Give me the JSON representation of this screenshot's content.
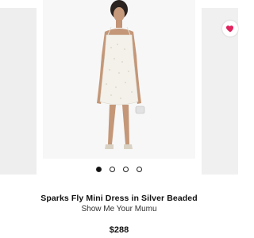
{
  "product": {
    "name": "Sparks Fly Mini Dress in Silver Beaded",
    "brand": "Show Me Your Mumu",
    "price": "$288",
    "image_icon": "dress-photo",
    "favorite_icon": "heart-icon"
  },
  "carousel": {
    "dot_count": 4,
    "active_index": 0
  },
  "colors": {
    "favorite": "#e0245e",
    "dress": "#f3f1ea"
  }
}
